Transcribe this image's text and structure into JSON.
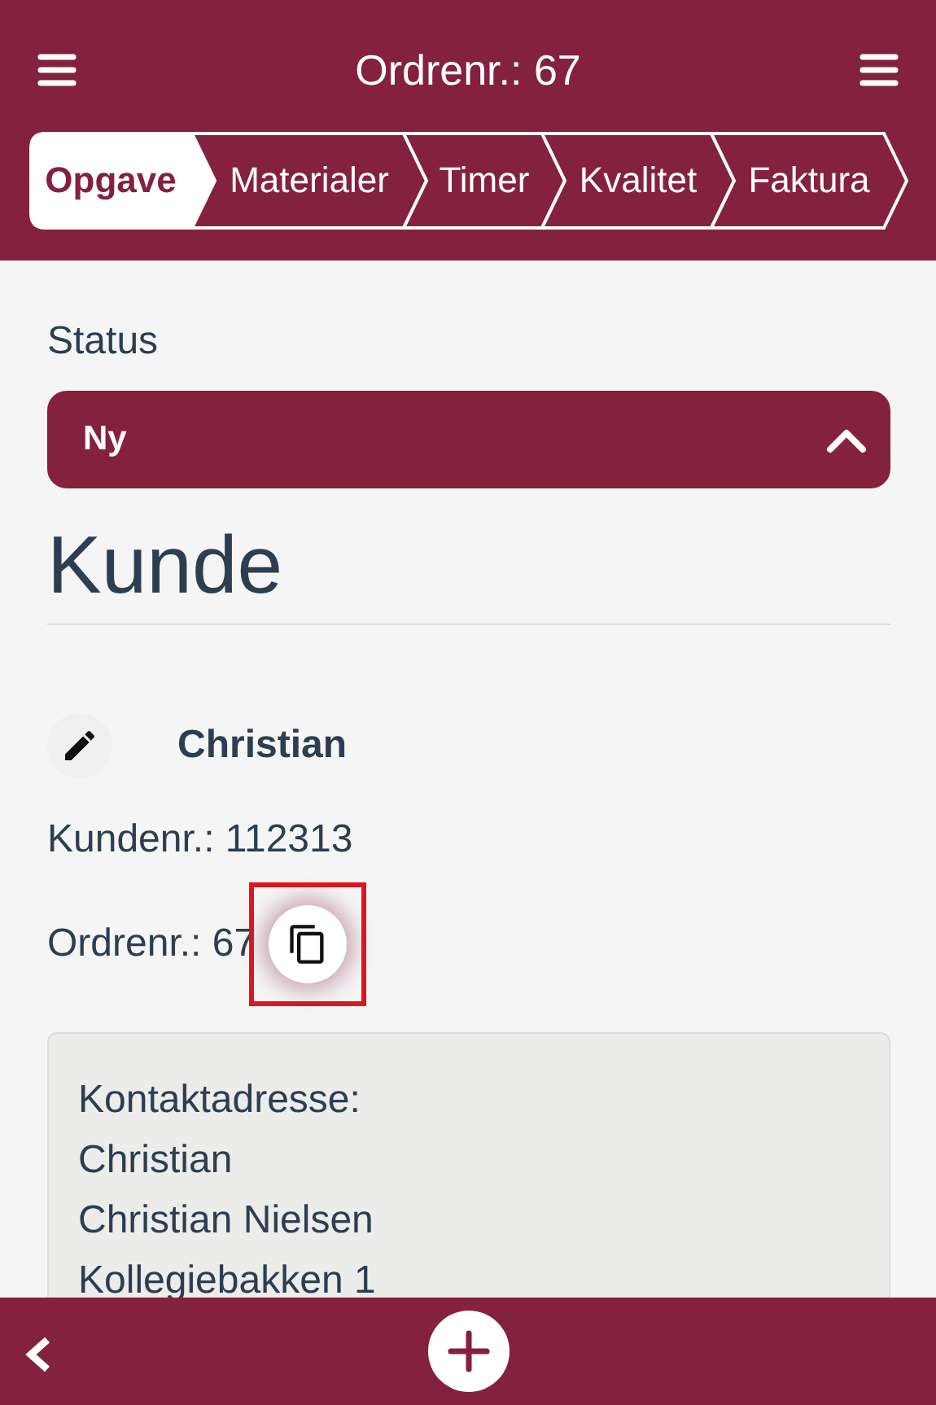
{
  "header": {
    "title": "Ordrenr.: 67"
  },
  "tabs": [
    {
      "label": "Opgave",
      "selected": true
    },
    {
      "label": "Materialer",
      "selected": false
    },
    {
      "label": "Timer",
      "selected": false
    },
    {
      "label": "Kvalitet",
      "selected": false
    },
    {
      "label": "Faktura",
      "selected": false
    }
  ],
  "status": {
    "label": "Status",
    "value": "Ny",
    "expanded": true
  },
  "section_title": "Kunde",
  "customer": {
    "name": "Christian",
    "customer_number": "Kundenr.: 112313",
    "order_number": "Ordrenr.: 67",
    "copy_highlighted": true
  },
  "address_lines": [
    "Kontaktadresse:",
    "Christian",
    "Christian Nielsen",
    "Kollegiebakken 1"
  ]
}
